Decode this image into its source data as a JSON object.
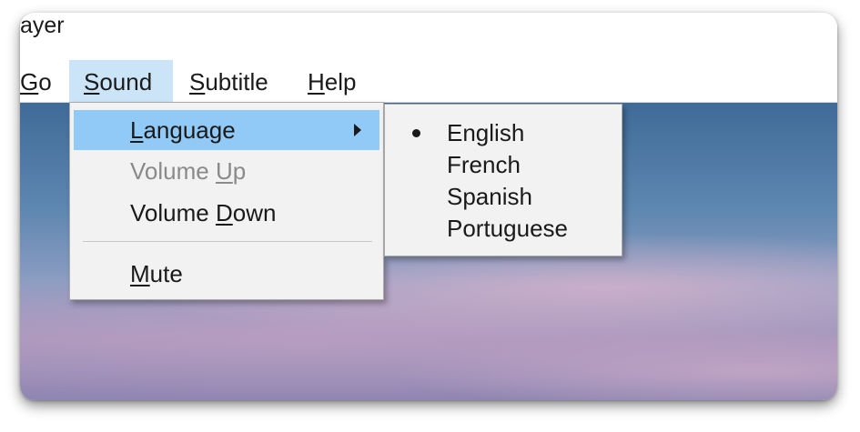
{
  "window": {
    "title_fragment": "ayer"
  },
  "menubar": {
    "items": [
      {
        "label_prefix": "",
        "mnemonic": "G",
        "label_rest": "o"
      },
      {
        "label_prefix": "",
        "mnemonic": "S",
        "label_rest": "ound"
      },
      {
        "label_prefix": "",
        "mnemonic": "S",
        "label_rest": "ubtitle"
      },
      {
        "label_prefix": "",
        "mnemonic": "H",
        "label_rest": "elp"
      }
    ],
    "active_index": 1
  },
  "sound_menu": {
    "items": [
      {
        "prefix": "",
        "mnemonic": "L",
        "rest": "anguage",
        "state": "highlighted",
        "has_submenu": true
      },
      {
        "prefix": "Volume ",
        "mnemonic": "U",
        "rest": "p",
        "state": "disabled",
        "has_submenu": false
      },
      {
        "prefix": "Volume ",
        "mnemonic": "D",
        "rest": "own",
        "state": "enabled",
        "has_submenu": false
      },
      {
        "prefix": "",
        "mnemonic": "M",
        "rest": "ute",
        "state": "enabled",
        "has_submenu": false
      }
    ],
    "submenu_arrow_icon": "chevron-right-icon"
  },
  "language_submenu": {
    "items": [
      "English",
      "French",
      "Spanish",
      "Portuguese"
    ],
    "selected": "English",
    "selected_icon": "bullet-icon"
  },
  "colors": {
    "menu_highlight": "#91c9f7",
    "menubar_active": "#cce4f7",
    "menu_background": "#f2f2f2",
    "disabled_text": "#8a8a8a"
  }
}
